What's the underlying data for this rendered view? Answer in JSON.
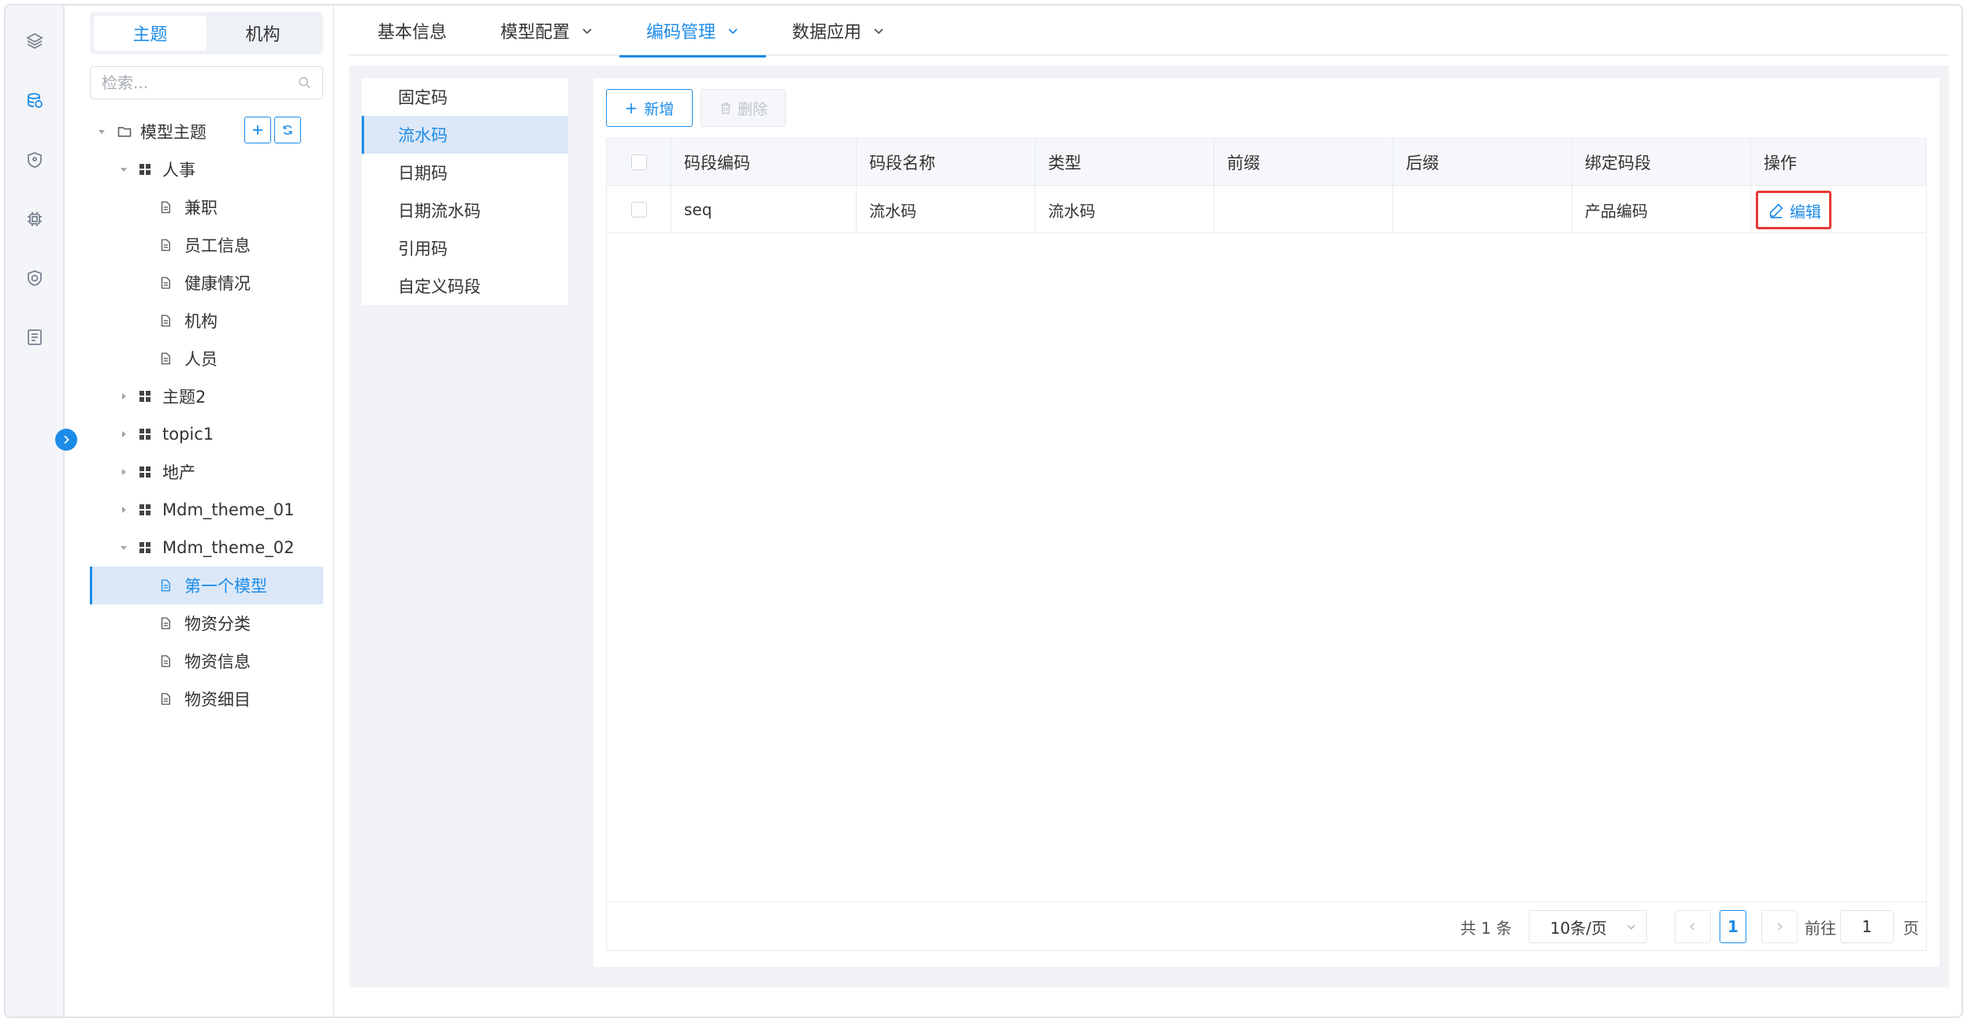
{
  "segment": {
    "tabs": [
      "主题",
      "机构"
    ],
    "active": 0
  },
  "search": {
    "placeholder": "检索..."
  },
  "tree": {
    "root": "模型主题",
    "nodes": [
      {
        "label": "人事",
        "children": [
          "兼职",
          "员工信息",
          "健康情况",
          "机构",
          "人员"
        ]
      },
      {
        "label": "主题2"
      },
      {
        "label": "topic1"
      },
      {
        "label": "地产"
      },
      {
        "label": "Mdm_theme_01"
      },
      {
        "label": "Mdm_theme_02",
        "children": [
          "第一个模型",
          "物资分类",
          "物资信息",
          "物资细目"
        ]
      }
    ],
    "selected": "第一个模型"
  },
  "tabs": [
    {
      "label": "基本信息"
    },
    {
      "label": "模型配置"
    },
    {
      "label": "编码管理"
    },
    {
      "label": "数据应用"
    }
  ],
  "active_tab": "编码管理",
  "subnav": {
    "items": [
      "固定码",
      "流水码",
      "日期码",
      "日期流水码",
      "引用码",
      "自定义码段"
    ],
    "active": "流水码"
  },
  "toolbar": {
    "add_label": "新增",
    "delete_label": "删除"
  },
  "table": {
    "columns": [
      "码段编码",
      "码段名称",
      "类型",
      "前缀",
      "后缀",
      "绑定码段",
      "操作"
    ],
    "rows": [
      {
        "code": "seq",
        "name": "流水码",
        "type": "流水码",
        "prefix": "",
        "suffix": "",
        "bound": "产品编码",
        "action": "编辑"
      }
    ]
  },
  "pagination": {
    "total_label": "共 1 条",
    "page_size": "10条/页",
    "current_page": "1",
    "goto_label": "前往",
    "goto_value": "1",
    "page_suffix": "页"
  },
  "colors": {
    "accent": "#1d8ce8",
    "highlight_border": "#e53935"
  }
}
